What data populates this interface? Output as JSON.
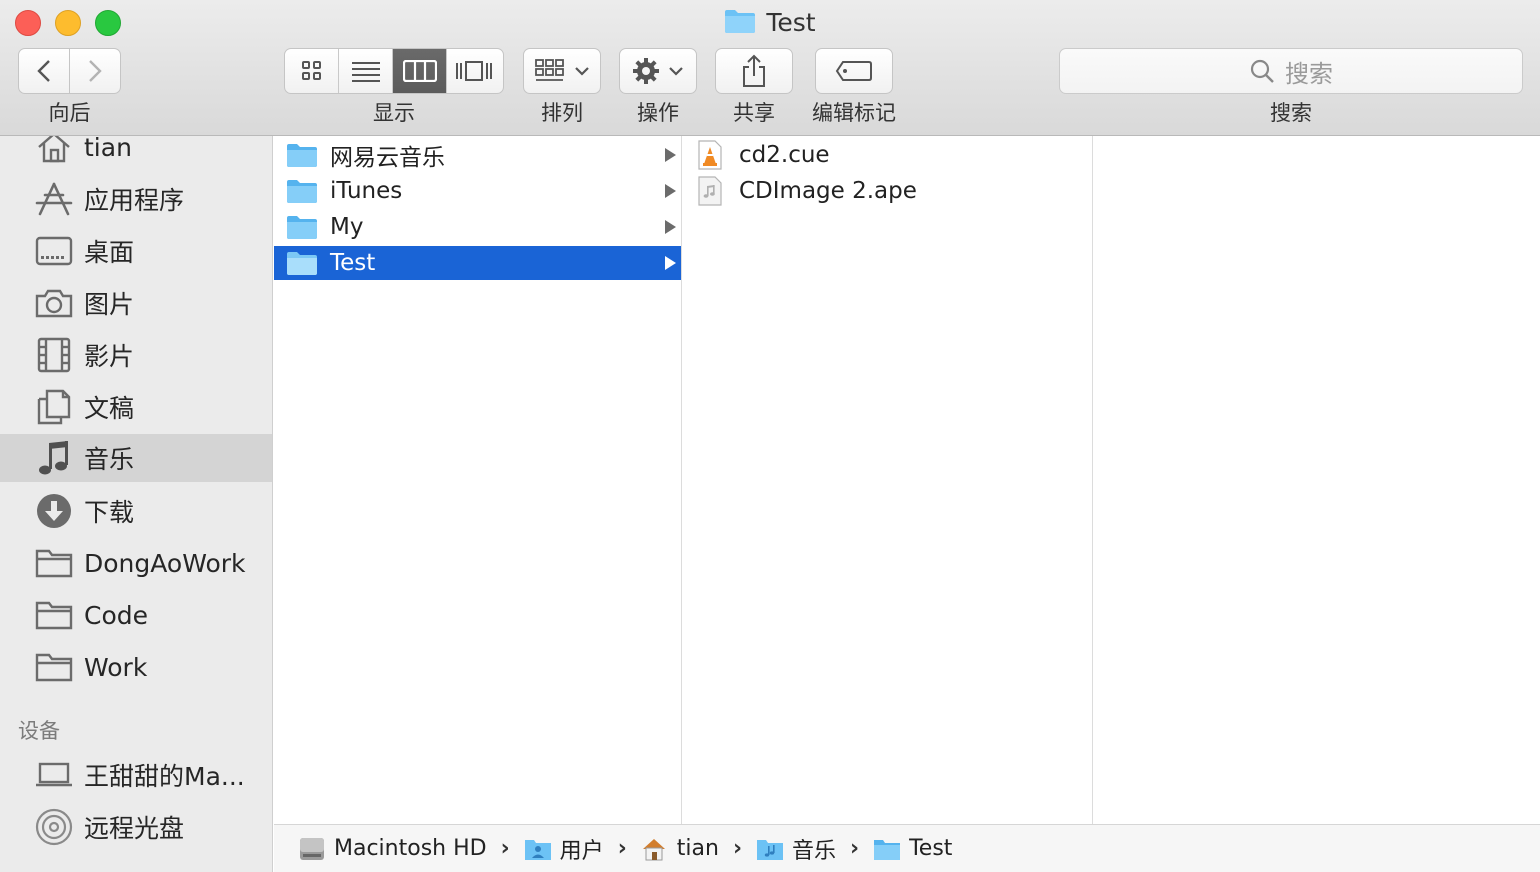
{
  "window": {
    "title": "Test"
  },
  "toolbar": {
    "nav_label": "向后",
    "view_label": "显示",
    "arrange_label": "排列",
    "action_label": "操作",
    "share_label": "共享",
    "tags_label": "编辑标记",
    "search_label": "搜索",
    "search_placeholder": "搜索"
  },
  "sidebar": {
    "favorites": [
      {
        "label": "tian",
        "icon": "home-icon"
      },
      {
        "label": "应用程序",
        "icon": "applications-icon"
      },
      {
        "label": "桌面",
        "icon": "desktop-icon"
      },
      {
        "label": "图片",
        "icon": "camera-icon"
      },
      {
        "label": "影片",
        "icon": "film-icon"
      },
      {
        "label": "文稿",
        "icon": "documents-icon"
      },
      {
        "label": "音乐",
        "icon": "music-note-icon",
        "selected": true
      },
      {
        "label": "下载",
        "icon": "download-icon"
      },
      {
        "label": "DongAoWork",
        "icon": "folder-icon"
      },
      {
        "label": "Code",
        "icon": "folder-icon"
      },
      {
        "label": "Work",
        "icon": "folder-icon"
      }
    ],
    "devices_header": "设备",
    "devices": [
      {
        "label": "王甜甜的Ma...",
        "icon": "laptop-icon"
      },
      {
        "label": "远程光盘",
        "icon": "disc-icon"
      }
    ]
  },
  "column1": [
    {
      "label": "网易云音乐"
    },
    {
      "label": "iTunes"
    },
    {
      "label": "My"
    },
    {
      "label": "Test",
      "selected": true
    }
  ],
  "column2": [
    {
      "label": "cd2.cue",
      "icon": "vlc-file-icon"
    },
    {
      "label": "CDImage 2.ape",
      "icon": "audio-file-icon"
    }
  ],
  "pathbar": [
    {
      "label": "Macintosh HD",
      "icon": "hard-drive-icon"
    },
    {
      "label": "用户",
      "icon": "users-folder-icon"
    },
    {
      "label": "tian",
      "icon": "home-icon"
    },
    {
      "label": "音乐",
      "icon": "music-folder-icon"
    },
    {
      "label": "Test",
      "icon": "folder-icon"
    }
  ],
  "colors": {
    "selection": "#1a64d6",
    "folder": "#6cc2f5",
    "sidebar_bg": "#ebebeb"
  }
}
